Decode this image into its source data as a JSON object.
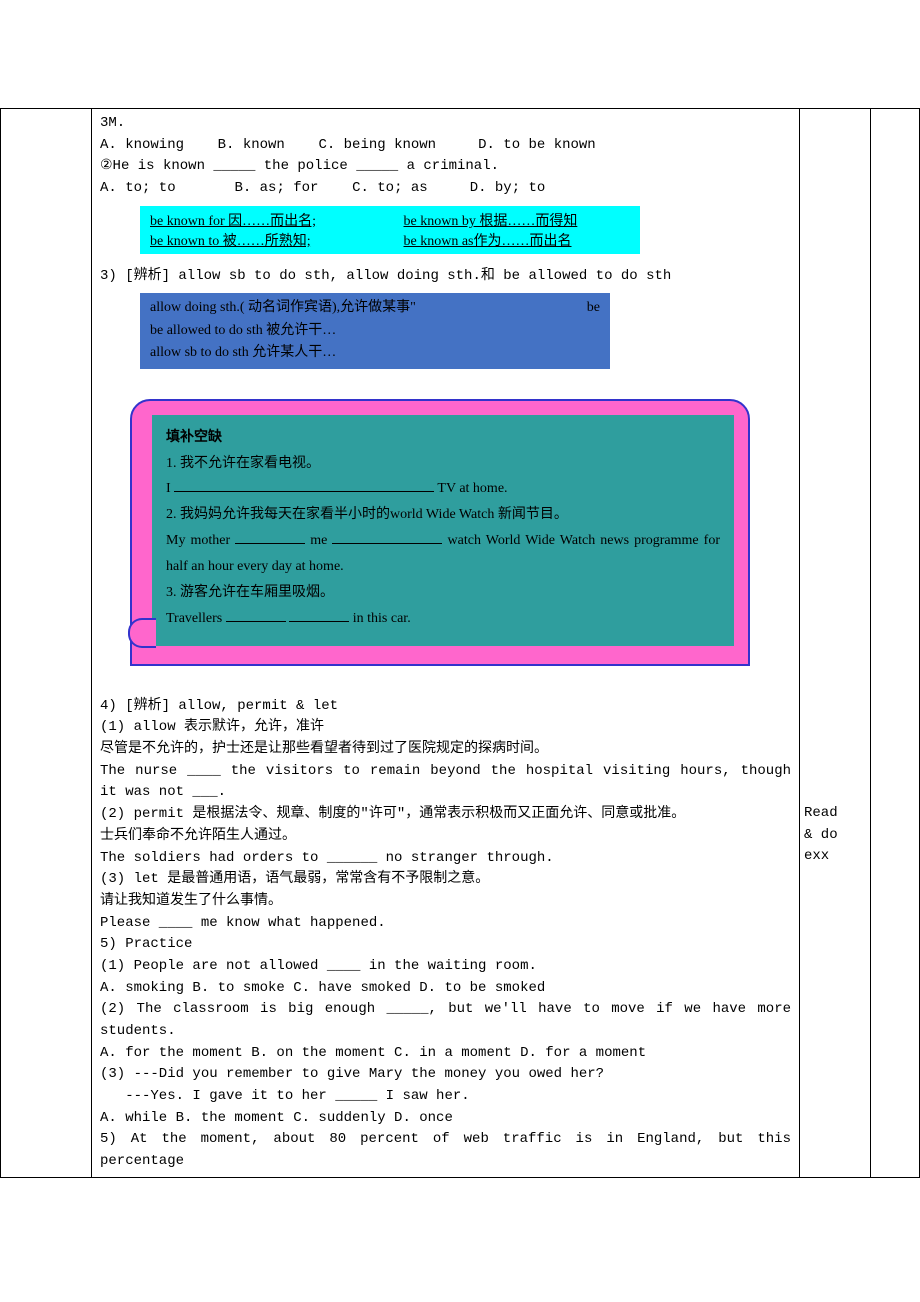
{
  "top": {
    "line1": "3M.",
    "optA": "A. knowing",
    "optB": "B. known",
    "optC": "C. being known",
    "optD": "D. to be known",
    "q2": "②He is known _____ the police _____ a criminal.",
    "q2A": "A. to; to",
    "q2B": "B. as; for",
    "q2C": "C. to; as",
    "q2D": "D. by; to"
  },
  "cyan": {
    "a": "be known for 因……而出名;",
    "b": "be known by 根据……而得知",
    "c": "be known to 被……所熟知;",
    "d": "be known as作为……而出名"
  },
  "sec3": {
    "head": "3) [辨析] allow sb to do sth, allow doing sth.和 be allowed to do sth",
    "b1a": "allow doing sth.( 动名词作宾语),允许做某事\"",
    "b1b": "be allowed to do sth   被允许干…",
    "b1c": "allow sb to do sth  允许某人干…",
    "b1right": "be"
  },
  "callout": {
    "title": "填补空缺",
    "l1": "1. 我不允许在家看电视。",
    "l2a": " I ",
    "l2b": " TV at home.",
    "l3": "2.  我妈妈允许我每天在家看半小时的world Wide Watch 新闻节目。",
    "l4a": "My mother ",
    "l4b": " me ",
    "l4c": " watch World Wide Watch news programme for half an hour every day at home.",
    "l5": "3.  游客允许在车厢里吸烟。",
    "l6a": " Travellers ",
    "l6b": " in this car."
  },
  "sec4": {
    "head": "4) [辨析] allow, permit & let",
    "p1": "(1) allow 表示默许，允许，准许",
    "p1cn": "尽管是不允许的，护士还是让那些看望者待到过了医院规定的探病时间。",
    "p1en": "The nurse ____ the visitors to remain beyond the hospital visiting hours, though it was not ___.",
    "p2": "(2) permit 是根据法令、规章、制度的\"许可\"，通常表示积极而又正面允许、同意或批准。",
    "p2cn": "士兵们奉命不允许陌生人通过。",
    "p2en": "The soldiers had orders to ______ no stranger through.",
    "p3": "(3) let 是最普通用语，语气最弱，常常含有不予限制之意。",
    "p3cn": "请让我知道发生了什么事情。",
    "p3en": "Please ____ me know what happened."
  },
  "sec5": {
    "head": "5) Practice",
    "q1": "(1) People are not allowed ____ in the waiting room.",
    "q1opt": "A. smoking  B. to smoke  C. have smoked  D. to be smoked",
    "q2": "(2) The classroom is big enough _____, but we'll have to move if we have more students.",
    "q2opt": "A. for the moment   B. on the moment    C. in a moment    D. for a moment",
    "q3a": "(3) ---Did you remember to give Mary the money you owed her?",
    "q3b": "   ---Yes. I gave it to her _____ I saw her.",
    "q3opt": "A. while    B. the moment    C. suddenly    D. once",
    "q5": "5) At the moment, about 80 percent of web traffic is in England, but this percentage"
  },
  "actions": {
    "a1": "Read",
    "a2": "& do",
    "a3": "exx"
  }
}
